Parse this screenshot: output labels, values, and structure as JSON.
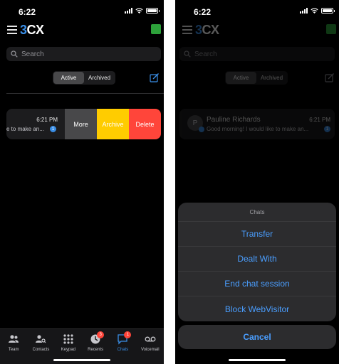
{
  "status": {
    "time": "6:22"
  },
  "header": {
    "logo_three": "3",
    "logo_cx": "CX"
  },
  "search": {
    "placeholder": "Search"
  },
  "segments": {
    "active": "Active",
    "archived": "Archived"
  },
  "left_row": {
    "time": "6:21 PM",
    "preview": "e to make an...",
    "unread": "1",
    "actions": {
      "more": "More",
      "archive": "Archive",
      "delete": "Delete"
    }
  },
  "tabs": [
    {
      "label": "Team",
      "icon": "team-icon"
    },
    {
      "label": "Contacts",
      "icon": "contacts-icon"
    },
    {
      "label": "Keypad",
      "icon": "keypad-icon"
    },
    {
      "label": "Recents",
      "icon": "recents-icon",
      "badge": "3"
    },
    {
      "label": "Chats",
      "icon": "chats-icon",
      "badge": "1",
      "active": true
    },
    {
      "label": "Voicemail",
      "icon": "voicemail-icon"
    }
  ],
  "right_row": {
    "avatar": "P",
    "name": "Pauline Richards",
    "time": "6:21 PM",
    "preview": "Good morning! I would like to make an...",
    "unread": "1"
  },
  "sheet": {
    "title": "Chats",
    "items": [
      "Transfer",
      "Dealt With",
      "End chat session",
      "Block WebVisitor"
    ],
    "cancel": "Cancel"
  },
  "colors": {
    "accent": "#3a8ee6",
    "presence": "#2da13a",
    "archive": "#ffcc00",
    "delete": "#ff453a",
    "more": "#48484a",
    "sheet_text": "#4a9eff"
  }
}
